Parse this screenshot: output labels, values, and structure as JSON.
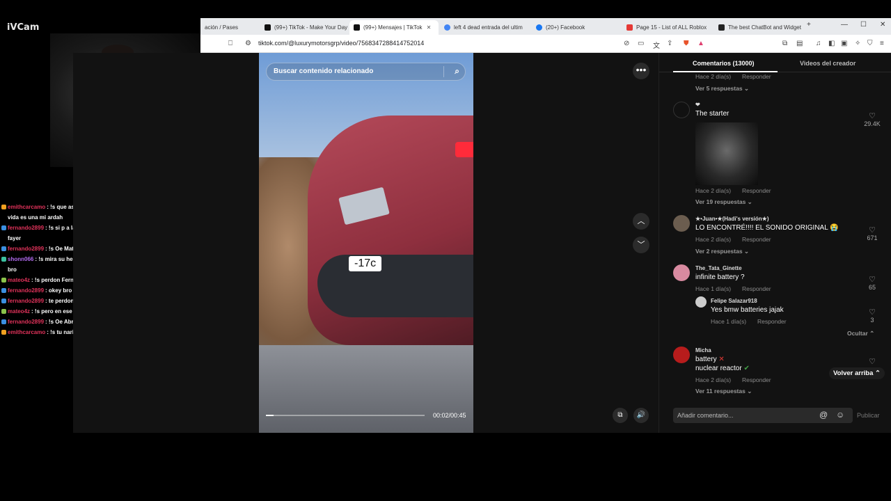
{
  "webcam": {
    "label": "iVCam"
  },
  "chat": [
    {
      "user": "emithcarcamo",
      "color": "red",
      "text": ": !s que asco la pc de mi ardah todo de mi ardah hasta su vida es una mi ardah"
    },
    {
      "user": "fernando2899",
      "color": "red",
      "text": ": !s si p a la firme yo vengo de los tiempos históricos del fri fayer"
    },
    {
      "user": "fernando2899",
      "color": "red",
      "text": ": !s Oe Mateo cierra la boca p"
    },
    {
      "user": "shonn066",
      "color": "purple",
      "text": ": !s mira su hermano ni aguanta un poco de diabetes solo dire k bro"
    },
    {
      "user": "mateo4z",
      "color": "red",
      "text": ": !s perdon Fernandito lo siento"
    },
    {
      "user": "fernando2899",
      "color": "red",
      "text": ": okey bro"
    },
    {
      "user": "fernando2899",
      "color": "red",
      "text": ": te perdono"
    },
    {
      "user": "mateo4z",
      "color": "red",
      "text": ": !s pero en ese avión solo avian zombies"
    },
    {
      "user": "fernando2899",
      "color": "red",
      "text": ": !s Oe Abram ya se porque la frozeeeeen se fue a spain"
    },
    {
      "user": "emithcarcamo",
      "color": "red",
      "text": ": !s tu nariz botando moco"
    }
  ],
  "browser": {
    "tabs": [
      {
        "label": "ación / Pases",
        "active": false
      },
      {
        "label": "(99+) TikTok - Make Your Day",
        "active": false
      },
      {
        "label": "(99+) Mensajes | TikTok",
        "active": true
      },
      {
        "label": "left 4 dead entrada del ultim",
        "active": false
      },
      {
        "label": "(20+) Facebook",
        "active": false
      },
      {
        "label": "Page 15 - List of ALL Roblox",
        "active": false
      },
      {
        "label": "The best ChatBot and Widget",
        "active": false
      }
    ],
    "url": "tiktok.com/@luxurymotorsgrp/video/7568347288414752014",
    "new_tab": "+",
    "minimize": "—",
    "maximize": "☐",
    "close": "✕"
  },
  "video": {
    "search_placeholder": "Buscar contenido relacionado",
    "overlay_label": "-17c",
    "time": "00:02/00:45",
    "progress_fraction": 0.05
  },
  "comments": {
    "tab_comments": "Comentarios (13000)",
    "tab_creator": "Videos del creador",
    "items": [
      {
        "meta_time": "Hace 2 día(s)",
        "reply": "Responder",
        "more": "Ver 5 respuestas ⌄"
      },
      {
        "user": "❤",
        "text": "The starter",
        "likes": "29.4K",
        "meta_time": "Hace 2 día(s)",
        "reply": "Responder",
        "more": "Ver 19 respuestas ⌄"
      },
      {
        "user": "★•Juan•★(Hadi's versión★)",
        "text": "LO ENCONTRÉ!!!! EL SONIDO ORIGINAL 😭",
        "likes": "671",
        "meta_time": "Hace 2 día(s)",
        "reply": "Responder",
        "more": "Ver 2 respuestas ⌄"
      },
      {
        "user": "The_Tata_Ginette",
        "text": "infinite battery ?",
        "likes": "65",
        "meta_time": "Hace 1 día(s)",
        "reply": "Responder"
      },
      {
        "user": "Felipe Salazar918",
        "text": "Yes bmw batteries jajak",
        "likes": "3",
        "meta_time": "Hace 1 día(s)",
        "reply": "Responder",
        "hide": "Ocultar ⌃"
      },
      {
        "user": "Micha",
        "line1": "battery",
        "line2": "nuclear reactor",
        "meta_time": "Hace 2 día(s)",
        "reply": "Responder",
        "more": "Ver 11 respuestas ⌄"
      }
    ],
    "back_to_top": "Volver arriba ⌃",
    "input_placeholder": "Añadir comentario...",
    "post": "Publicar"
  }
}
